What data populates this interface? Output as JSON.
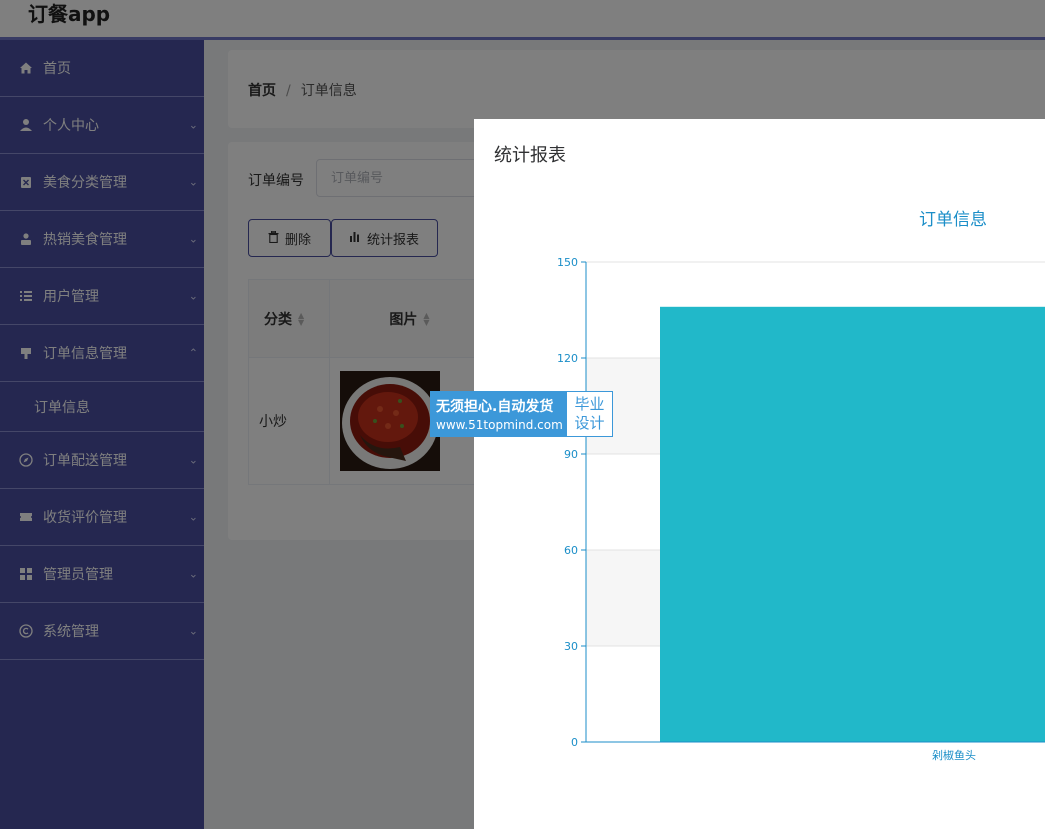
{
  "app": {
    "title": "订餐app"
  },
  "sidebar": {
    "items": [
      {
        "label": "首页",
        "icon": "home-icon",
        "chevron": ""
      },
      {
        "label": "个人中心",
        "icon": "user-icon",
        "chevron": "down"
      },
      {
        "label": "美食分类管理",
        "icon": "clipboard-icon",
        "chevron": "down"
      },
      {
        "label": "热销美食管理",
        "icon": "person-icon",
        "chevron": "down"
      },
      {
        "label": "用户管理",
        "icon": "list-icon",
        "chevron": "down"
      },
      {
        "label": "订单信息管理",
        "icon": "flag-icon",
        "chevron": "up"
      },
      {
        "label": "订单配送管理",
        "icon": "compass-icon",
        "chevron": "down"
      },
      {
        "label": "收货评价管理",
        "icon": "ticket-icon",
        "chevron": "down"
      },
      {
        "label": "管理员管理",
        "icon": "grid-icon",
        "chevron": "down"
      },
      {
        "label": "系统管理",
        "icon": "copyright-icon",
        "chevron": "down"
      }
    ],
    "submenu": {
      "label": "订单信息"
    }
  },
  "breadcrumb": {
    "home": "首页",
    "separator": "/",
    "current": "订单信息"
  },
  "search": {
    "label": "订单编号",
    "placeholder": "订单编号"
  },
  "toolbar": {
    "delete_label": "删除",
    "stats_label": "统计报表"
  },
  "table": {
    "headers": [
      "分类",
      "图片"
    ],
    "rows": [
      {
        "category": "小炒"
      }
    ]
  },
  "dialog": {
    "title": "统计报表"
  },
  "watermark": {
    "line1": "无须担心.自动发货",
    "line2": "www.51topmind.com",
    "right1": "毕业",
    "right2": "设计"
  },
  "colors": {
    "sidebar": "#4a4fa0",
    "bar": "#21b8c9",
    "axis": "#1b8ec8"
  },
  "chart_data": {
    "type": "bar",
    "title": "订单信息",
    "categories": [
      "剁椒鱼头"
    ],
    "values": [
      136
    ],
    "yticks": [
      0,
      30,
      60,
      90,
      120,
      150
    ],
    "ylim": [
      0,
      150
    ],
    "grid": true
  }
}
